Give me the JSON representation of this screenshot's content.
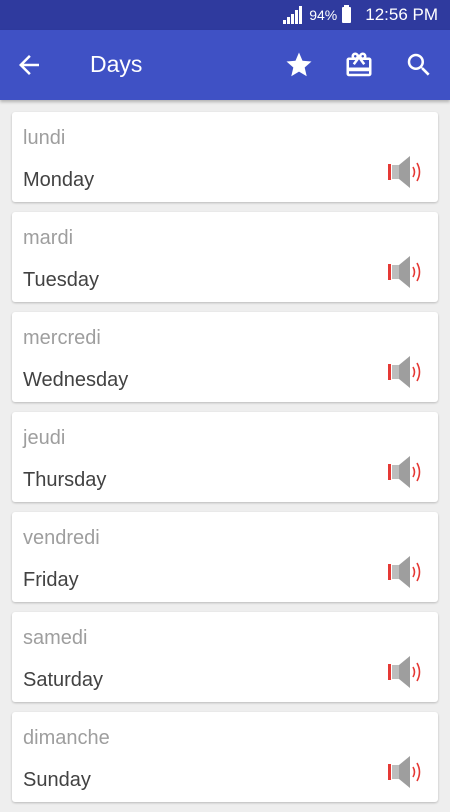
{
  "status_bar": {
    "battery_percent": "94%",
    "time": "12:56 PM"
  },
  "app_bar": {
    "title": "Days",
    "icons": [
      "back-arrow-icon",
      "star-icon",
      "gift-card-icon",
      "search-icon"
    ]
  },
  "colors": {
    "status_bar": "#2f3a9e",
    "app_bar": "#3f51c5",
    "background": "#eeeeee",
    "speaker_gray": "#9e9e9e",
    "speaker_waves": "#e53935"
  },
  "words": [
    {
      "french": "lundi",
      "english": "Monday"
    },
    {
      "french": "mardi",
      "english": "Tuesday"
    },
    {
      "french": "mercredi",
      "english": "Wednesday"
    },
    {
      "french": "jeudi",
      "english": "Thursday"
    },
    {
      "french": "vendredi",
      "english": "Friday"
    },
    {
      "french": "samedi",
      "english": "Saturday"
    },
    {
      "french": "dimanche",
      "english": "Sunday"
    }
  ]
}
